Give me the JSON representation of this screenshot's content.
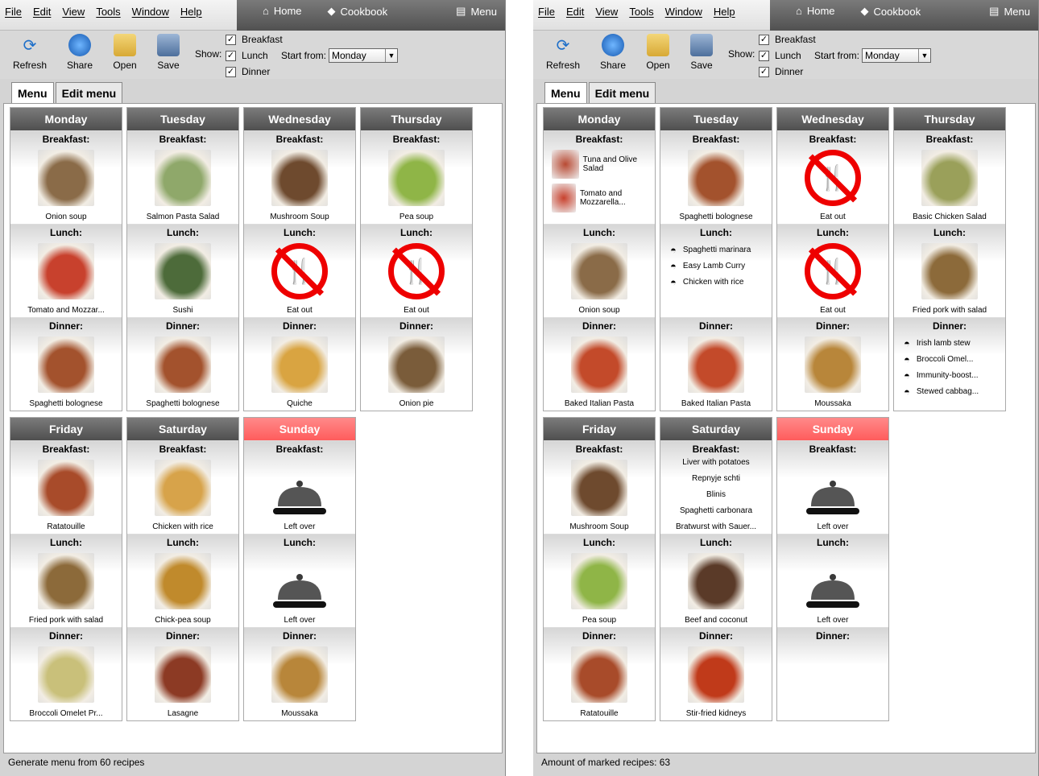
{
  "menubar": [
    "File",
    "Edit",
    "View",
    "Tools",
    "Window",
    "Help"
  ],
  "nav": {
    "home": "Home",
    "cookbook": "Cookbook",
    "menu": "Menu"
  },
  "toolbar": {
    "refresh": "Refresh",
    "share": "Share",
    "open": "Open",
    "save": "Save",
    "show": "Show:",
    "start_from": "Start from:",
    "start_value": "Monday"
  },
  "meals": {
    "breakfast": "Breakfast",
    "lunch": "Lunch",
    "dinner": "Dinner"
  },
  "tabs": {
    "menu": "Menu",
    "edit": "Edit menu"
  },
  "left": {
    "status": "Generate menu from 60 recipes",
    "days": [
      {
        "name": "Monday",
        "meals": [
          {
            "label": "Breakfast:",
            "name": "Onion soup",
            "kind": "img",
            "color": "#8a6b48"
          },
          {
            "label": "Lunch:",
            "name": "Tomato and Mozzar...",
            "kind": "img",
            "color": "#c8412d"
          },
          {
            "label": "Dinner:",
            "name": "Spaghetti bolognese",
            "kind": "img",
            "color": "#a3522d"
          }
        ]
      },
      {
        "name": "Tuesday",
        "meals": [
          {
            "label": "Breakfast:",
            "name": "Salmon Pasta Salad",
            "kind": "img",
            "color": "#8fa86a"
          },
          {
            "label": "Lunch:",
            "name": "Sushi",
            "kind": "img",
            "color": "#4d6b3a"
          },
          {
            "label": "Dinner:",
            "name": "Spaghetti bolognese",
            "kind": "img",
            "color": "#a3522d"
          }
        ]
      },
      {
        "name": "Wednesday",
        "meals": [
          {
            "label": "Breakfast:",
            "name": "Mushroom Soup",
            "kind": "img",
            "color": "#6e4a2e"
          },
          {
            "label": "Lunch:",
            "name": "Eat out",
            "kind": "noeat"
          },
          {
            "label": "Dinner:",
            "name": "Quiche",
            "kind": "img",
            "color": "#d9a441"
          }
        ]
      },
      {
        "name": "Thursday",
        "meals": [
          {
            "label": "Breakfast:",
            "name": "Pea soup",
            "kind": "img",
            "color": "#8fb547"
          },
          {
            "label": "Lunch:",
            "name": "Eat out",
            "kind": "noeat"
          },
          {
            "label": "Dinner:",
            "name": "Onion pie",
            "kind": "img",
            "color": "#7a5c3a"
          }
        ]
      },
      {
        "name": "Friday",
        "meals": [
          {
            "label": "Breakfast:",
            "name": "Ratatouille",
            "kind": "img",
            "color": "#a84b2a"
          },
          {
            "label": "Lunch:",
            "name": "Fried pork with salad",
            "kind": "img",
            "color": "#8c6a3a"
          },
          {
            "label": "Dinner:",
            "name": "Broccoli Omelet Pr...",
            "kind": "img",
            "color": "#c9c07a"
          }
        ]
      },
      {
        "name": "Saturday",
        "meals": [
          {
            "label": "Breakfast:",
            "name": "Chicken with rice",
            "kind": "img",
            "color": "#d7a34a"
          },
          {
            "label": "Lunch:",
            "name": "Chick-pea soup",
            "kind": "img",
            "color": "#c08a2c"
          },
          {
            "label": "Dinner:",
            "name": "Lasagne",
            "kind": "img",
            "color": "#8c3a24"
          }
        ]
      },
      {
        "name": "Sunday",
        "sunday": true,
        "meals": [
          {
            "label": "Breakfast:",
            "name": "Left over",
            "kind": "cloche"
          },
          {
            "label": "Lunch:",
            "name": "Left over",
            "kind": "cloche"
          },
          {
            "label": "Dinner:",
            "name": "Moussaka",
            "kind": "img",
            "color": "#b8863a"
          }
        ]
      }
    ]
  },
  "right": {
    "status": "Amount of marked recipes: 63",
    "days": [
      {
        "name": "Monday",
        "meals": [
          {
            "label": "Breakfast:",
            "kind": "thumbs",
            "items": [
              {
                "name": "Tuna and Olive Salad",
                "color": "#b84a33"
              },
              {
                "name": "Tomato and Mozzarella...",
                "color": "#c8412d"
              }
            ]
          },
          {
            "label": "Lunch:",
            "name": "Onion soup",
            "kind": "img",
            "color": "#8a6b48"
          },
          {
            "label": "Dinner:",
            "name": "Baked Italian Pasta",
            "kind": "img",
            "color": "#c34a2a"
          }
        ]
      },
      {
        "name": "Tuesday",
        "meals": [
          {
            "label": "Breakfast:",
            "name": "Spaghetti bolognese",
            "kind": "img",
            "color": "#a3522d"
          },
          {
            "label": "Lunch:",
            "kind": "list",
            "items": [
              "Spaghetti marinara",
              "Easy Lamb Curry",
              "Chicken with rice"
            ]
          },
          {
            "label": "Dinner:",
            "name": "Baked Italian Pasta",
            "kind": "img",
            "color": "#c34a2a"
          }
        ]
      },
      {
        "name": "Wednesday",
        "meals": [
          {
            "label": "Breakfast:",
            "name": "Eat out",
            "kind": "noeat"
          },
          {
            "label": "Lunch:",
            "name": "Eat out",
            "kind": "noeat"
          },
          {
            "label": "Dinner:",
            "name": "Moussaka",
            "kind": "img",
            "color": "#b8863a"
          }
        ]
      },
      {
        "name": "Thursday",
        "meals": [
          {
            "label": "Breakfast:",
            "name": "Basic Chicken Salad",
            "kind": "img",
            "color": "#9aa05a"
          },
          {
            "label": "Lunch:",
            "name": "Fried pork with salad",
            "kind": "img",
            "color": "#8c6a3a"
          },
          {
            "label": "Dinner:",
            "kind": "list",
            "items": [
              "Irish lamb stew",
              "Broccoli Omel...",
              "Immunity-boost...",
              "Stewed cabbag..."
            ]
          }
        ]
      },
      {
        "name": "Friday",
        "meals": [
          {
            "label": "Breakfast:",
            "name": "Mushroom Soup",
            "kind": "img",
            "color": "#6e4a2e"
          },
          {
            "label": "Lunch:",
            "name": "Pea soup",
            "kind": "img",
            "color": "#8fb547"
          },
          {
            "label": "Dinner:",
            "name": "Ratatouille",
            "kind": "img",
            "color": "#a84b2a"
          }
        ]
      },
      {
        "name": "Saturday",
        "meals": [
          {
            "label": "Breakfast:",
            "kind": "text",
            "items": [
              "Liver with potatoes",
              "Repnyje schti",
              "Blinis",
              "Spaghetti carbonara",
              "Bratwurst with Sauer..."
            ]
          },
          {
            "label": "Lunch:",
            "name": "Beef and coconut",
            "kind": "img",
            "color": "#5a3a28"
          },
          {
            "label": "Dinner:",
            "name": "Stir-fried kidneys",
            "kind": "img",
            "color": "#c03a1a"
          }
        ]
      },
      {
        "name": "Sunday",
        "sunday": true,
        "meals": [
          {
            "label": "Breakfast:",
            "name": "Left over",
            "kind": "cloche"
          },
          {
            "label": "Lunch:",
            "name": "Left over",
            "kind": "cloche"
          },
          {
            "label": "Dinner:",
            "kind": "empty"
          }
        ]
      }
    ]
  },
  "colors": {
    "sunday": "#ff6a6a",
    "header": "#5e5e5e",
    "noeat": "#e00000"
  }
}
